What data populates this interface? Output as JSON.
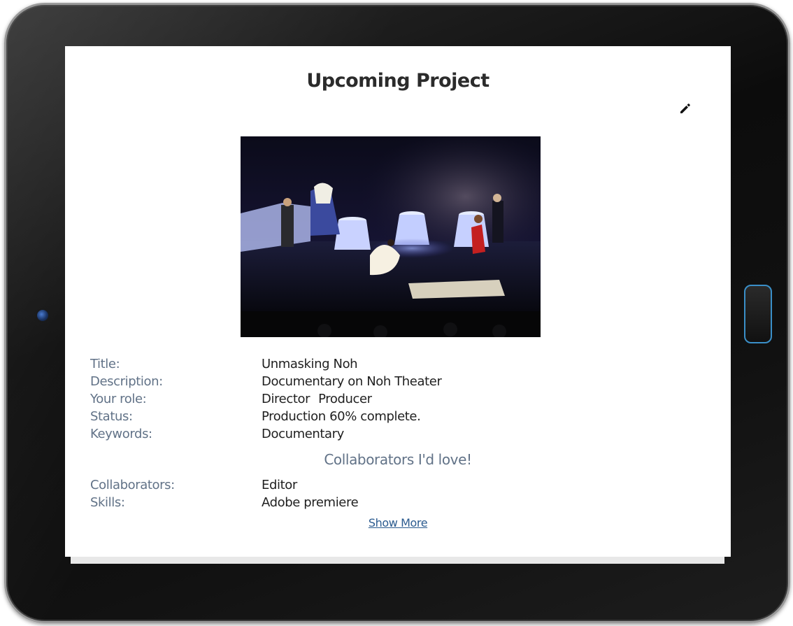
{
  "page": {
    "title": "Upcoming Project",
    "edit_icon": "pencil-icon"
  },
  "project": {
    "image": "stage-performance-photo",
    "fields": [
      {
        "label": "Title:",
        "value": "Unmasking Noh"
      },
      {
        "label": "Description:",
        "value": "Documentary on Noh Theater"
      },
      {
        "label": "Your role:",
        "roles": [
          "Director",
          "Producer"
        ]
      },
      {
        "label": "Status:",
        "value": "Production 60% complete."
      },
      {
        "label": "Keywords:",
        "value": "Documentary"
      }
    ]
  },
  "collaborators_section": {
    "heading": "Collaborators I'd love!",
    "fields": [
      {
        "label": "Collaborators:",
        "value": "Editor"
      },
      {
        "label": "Skills:",
        "value": "Adobe premiere"
      }
    ]
  },
  "show_more_label": "Show More",
  "colors": {
    "label": "#617287",
    "link": "#2b5b8f",
    "home_button_ring": "#3a8fc8"
  }
}
